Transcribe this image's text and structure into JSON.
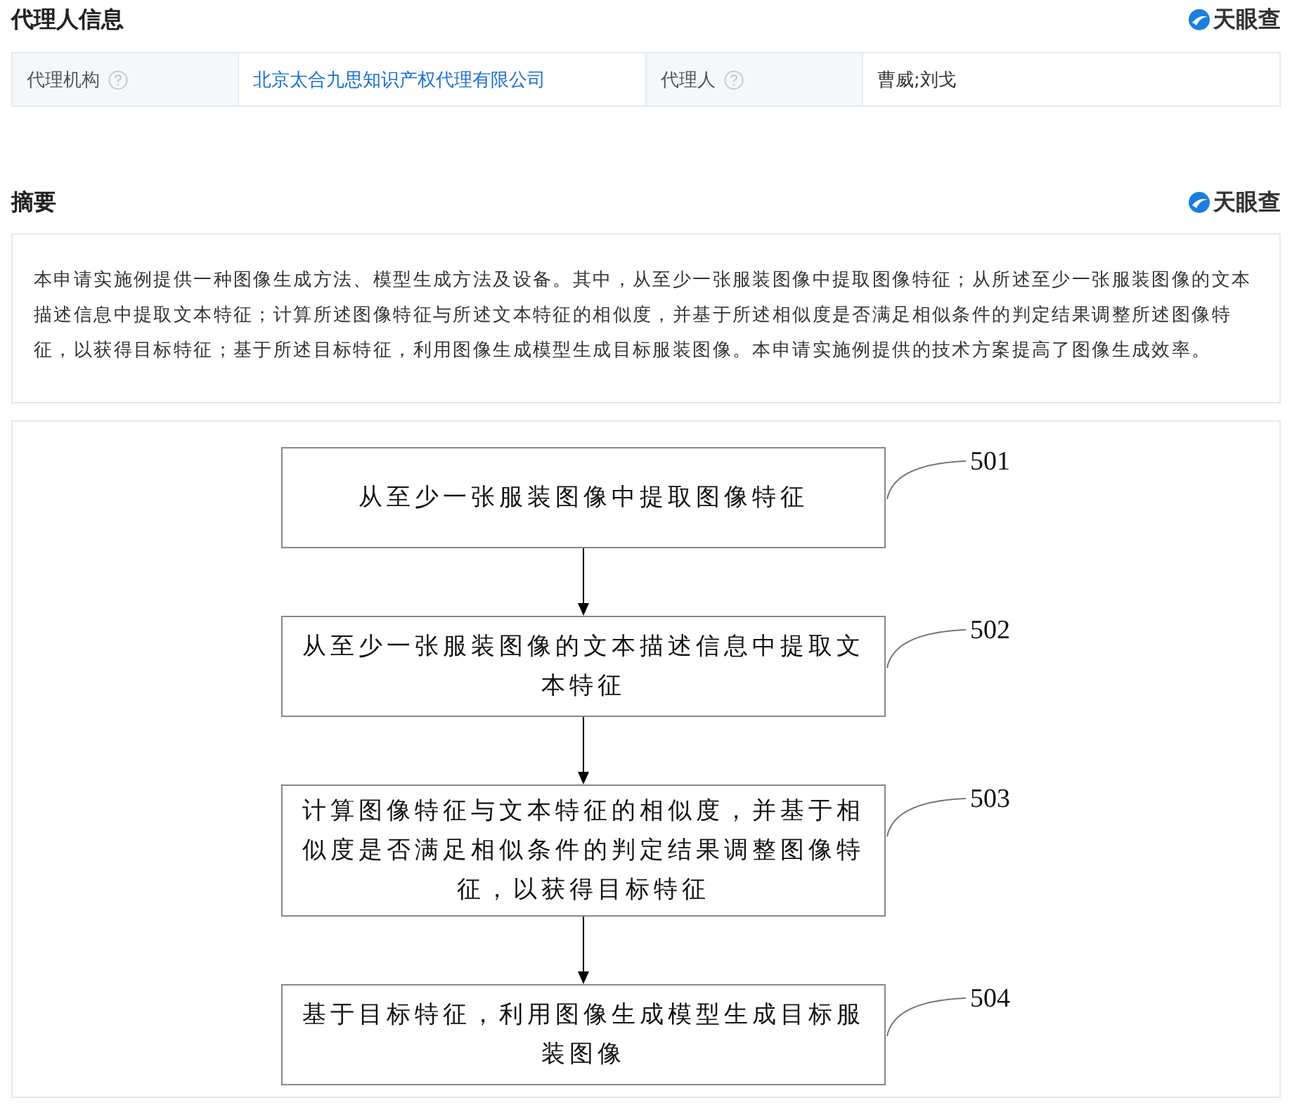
{
  "agent_section": {
    "title": "代理人信息",
    "logo": "天眼查",
    "fields": [
      {
        "label": "代理机构",
        "value": "北京太合九思知识产权代理有限公司",
        "link": true
      },
      {
        "label": "代理人",
        "value": "曹威;刘戈",
        "link": false
      }
    ]
  },
  "abstract_section": {
    "title": "摘要",
    "logo": "天眼查",
    "text": "本申请实施例提供一种图像生成方法、模型生成方法及设备。其中，从至少一张服装图像中提取图像特征；从所述至少一张服装图像的文本描述信息中提取文本特征；计算所述图像特征与所述文本特征的相似度，并基于所述相似度是否满足相似条件的判定结果调整所述图像特征，以获得目标特征；基于所述目标特征，利用图像生成模型生成目标服装图像。本申请实施例提供的技术方案提高了图像生成效率。"
  },
  "flowchart": {
    "steps": [
      {
        "number": "501",
        "text": "从至少一张服装图像中提取图像特征"
      },
      {
        "number": "502",
        "text": "从至少一张服装图像的文本描述信息中提取文本特征"
      },
      {
        "number": "503",
        "text": "计算图像特征与文本特征的相似度，并基于相似度是否满足相似条件的判定结果调整图像特征，以获得目标特征"
      },
      {
        "number": "504",
        "text": "基于目标特征，利用图像生成模型生成目标服装图像"
      }
    ]
  }
}
